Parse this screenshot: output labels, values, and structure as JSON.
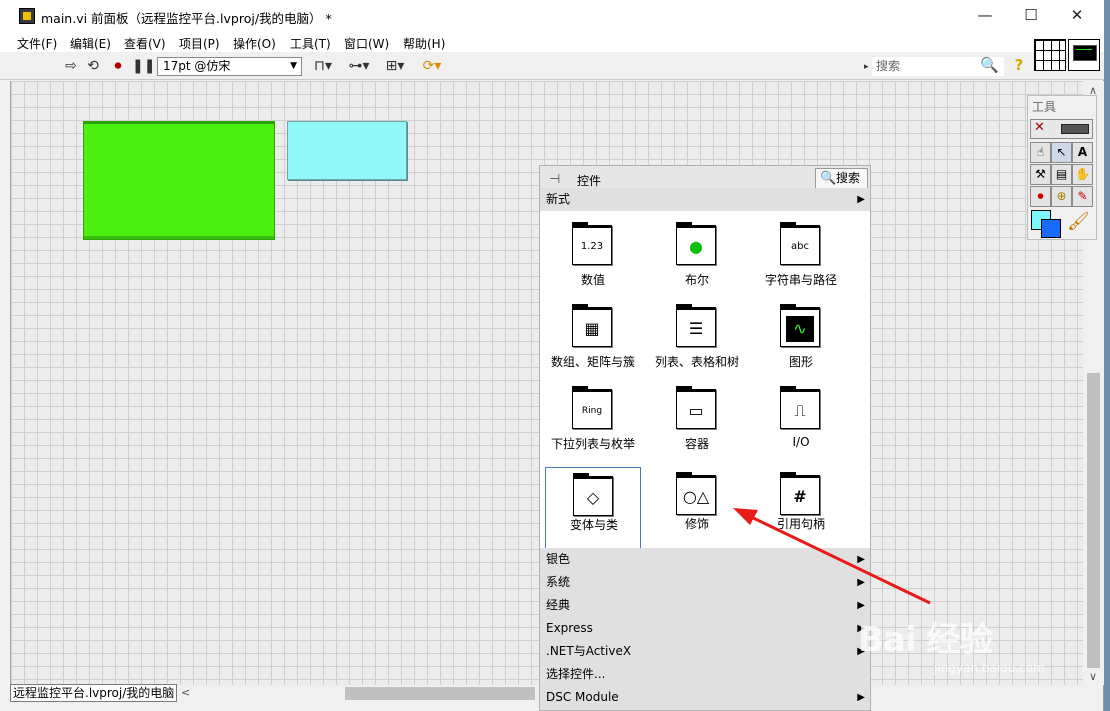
{
  "window": {
    "title": "main.vi 前面板（远程监控平台.lvproj/我的电脑） *",
    "controls": {
      "minimize": "—",
      "maximize": "☐",
      "close": "✕"
    }
  },
  "menubar": {
    "items": [
      "文件(F)",
      "编辑(E)",
      "查看(V)",
      "项目(P)",
      "操作(O)",
      "工具(T)",
      "窗口(W)",
      "帮助(H)"
    ]
  },
  "toolbar": {
    "run_icon": "run-arrow-icon",
    "font": "17pt @仿宋",
    "search_placeholder": "搜索"
  },
  "front_panel": {
    "objects": [
      {
        "name": "green-decoration",
        "color": "#4cf010"
      },
      {
        "name": "cyan-decoration",
        "color": "#92f8fa"
      }
    ],
    "status_path": "远程监控平台.lvproj/我的电脑"
  },
  "tools_palette": {
    "title": "工具"
  },
  "controls_palette": {
    "title": "控件",
    "search_label": "搜索",
    "top_category": "新式",
    "items": [
      {
        "label": "数值",
        "glyph": "1.23"
      },
      {
        "label": "布尔",
        "glyph": "●"
      },
      {
        "label": "字符串与路径",
        "glyph": "abc"
      },
      {
        "label": "数组、矩阵与簇",
        "glyph": "▦"
      },
      {
        "label": "列表、表格和树",
        "glyph": "☰"
      },
      {
        "label": "图形",
        "glyph": "∿"
      },
      {
        "label": "下拉列表与枚举",
        "glyph": "Ring"
      },
      {
        "label": "容器",
        "glyph": "▭"
      },
      {
        "label": "I/O",
        "glyph": "⎍"
      },
      {
        "label": "变体与类",
        "glyph": "◇"
      },
      {
        "label": "修饰",
        "glyph": "○△"
      },
      {
        "label": "引用句柄",
        "glyph": "#"
      }
    ],
    "categories": [
      "银色",
      "系统",
      "经典",
      "Express",
      ".NET与ActiveX",
      "选择控件...",
      "DSC Module"
    ]
  },
  "watermark": {
    "logo": "Bai  经验",
    "url": "jingyan.baidu.com"
  }
}
